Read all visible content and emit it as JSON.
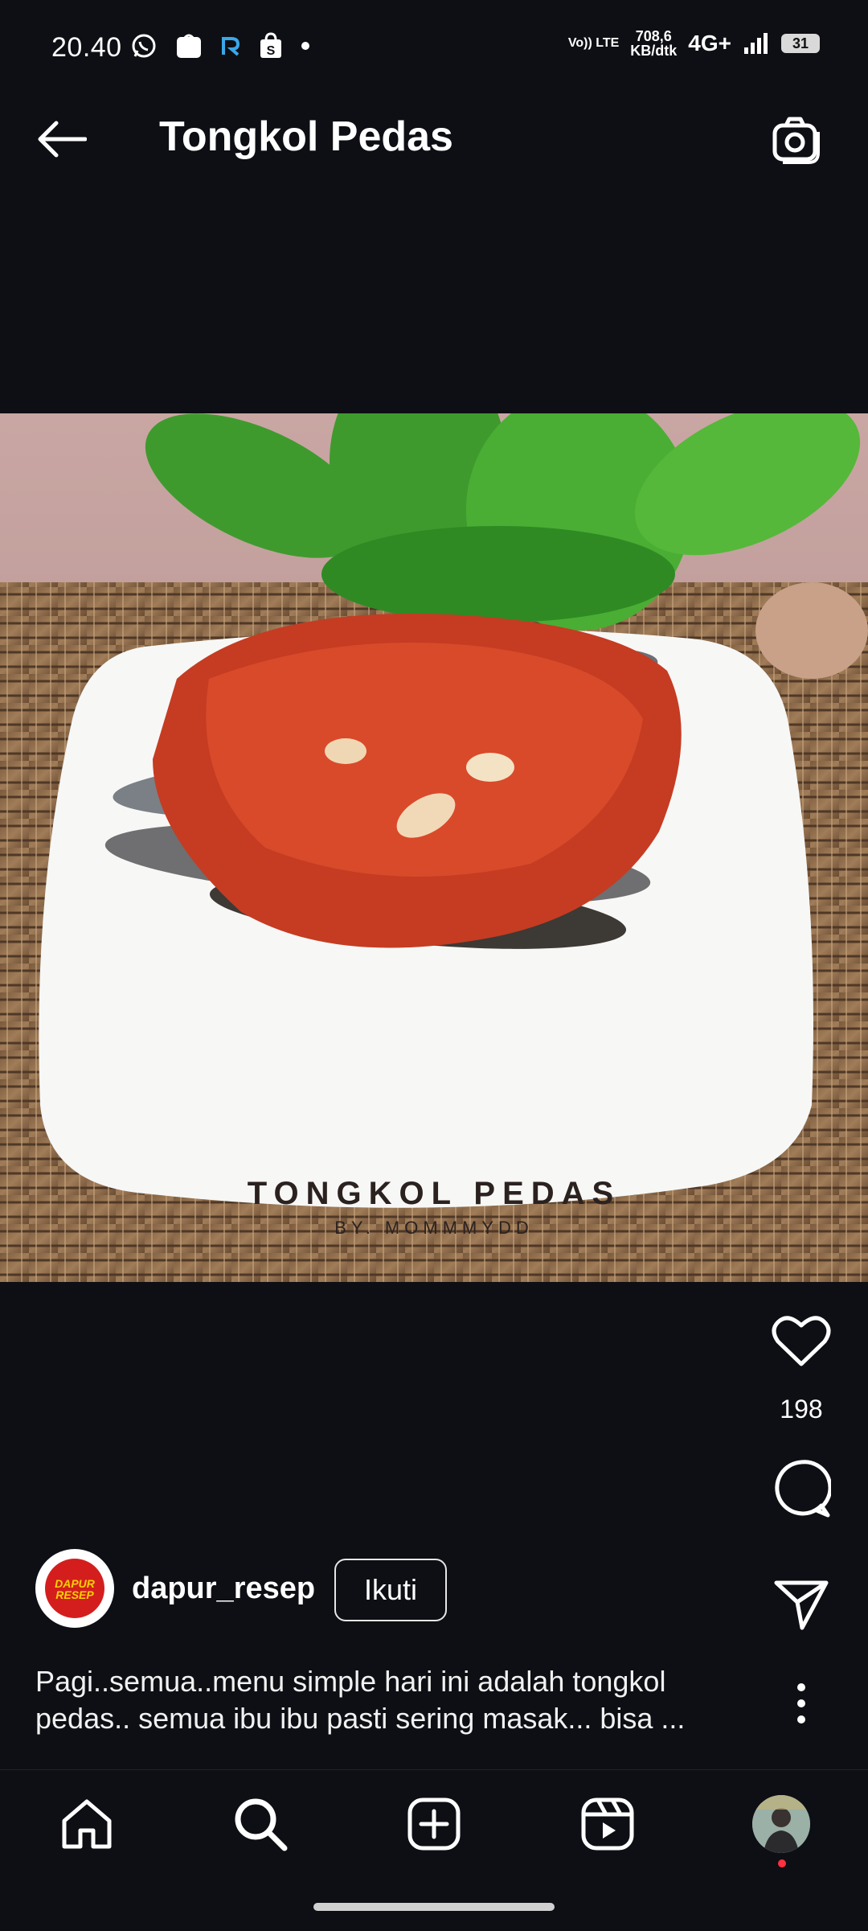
{
  "status_bar": {
    "time": "20.40",
    "net_lte": "Vo)) LTE",
    "net_speed_value": "708,6",
    "net_speed_unit": "KB/dtk",
    "network": "4G+",
    "battery": "31",
    "left_icons": [
      "whatsapp-icon",
      "shopee-icon",
      "r-app-icon",
      "shopping-bag-icon",
      "dot-icon"
    ]
  },
  "header": {
    "title": "Tongkol Pedas",
    "back_icon": "arrow-left-icon",
    "camera_icon": "camera-icon"
  },
  "post": {
    "image_title": "TONGKOL PEDAS",
    "image_subtitle": "BY. MOMMMYDD",
    "likes": "198",
    "author": {
      "username": "dapur_resep",
      "avatar_text_line1": "DAPUR",
      "avatar_text_line2": "RESEP",
      "follow_label": "Ikuti"
    },
    "caption": "Pagi..semua..menu simple hari ini adalah tongkol pedas.. semua ibu ibu pasti sering masak... bisa ..."
  },
  "bottom_nav": {
    "items": [
      "home-icon",
      "search-icon",
      "add-post-icon",
      "reels-icon",
      "profile-avatar"
    ]
  },
  "colors": {
    "background": "#0d0f14",
    "notification_dot": "#ff3040"
  }
}
